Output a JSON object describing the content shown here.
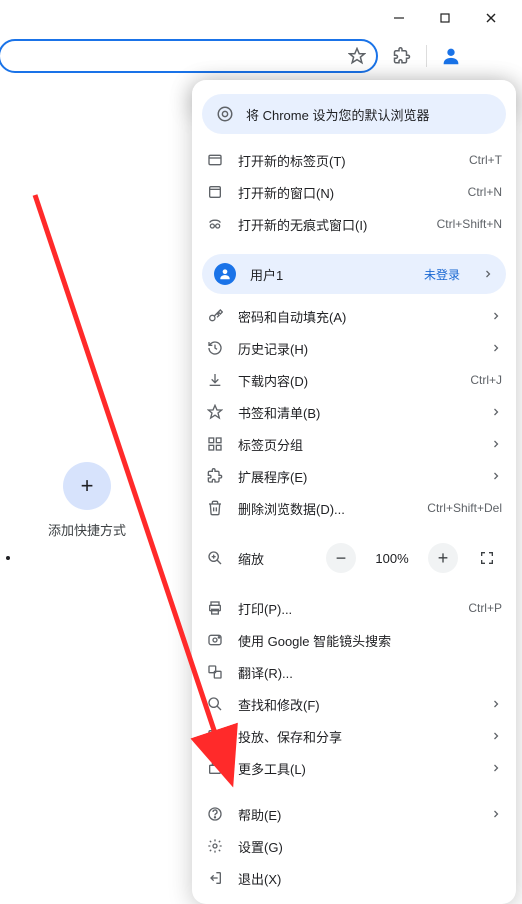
{
  "window": {},
  "toolbar": {},
  "shortcut": {
    "add_label": "添加快捷方式",
    "plus": "+"
  },
  "menu": {
    "default_browser": "将 Chrome 设为您的默认浏览器",
    "new_tab": {
      "label": "打开新的标签页(T)",
      "accel": "Ctrl+T"
    },
    "new_window": {
      "label": "打开新的窗口(N)",
      "accel": "Ctrl+N"
    },
    "incognito": {
      "label": "打开新的无痕式窗口(I)",
      "accel": "Ctrl+Shift+N"
    },
    "profile": {
      "name": "用户1",
      "status": "未登录"
    },
    "passwords": {
      "label": "密码和自动填充(A)"
    },
    "history": {
      "label": "历史记录(H)"
    },
    "downloads": {
      "label": "下载内容(D)",
      "accel": "Ctrl+J"
    },
    "bookmarks": {
      "label": "书签和清单(B)"
    },
    "tab_groups": {
      "label": "标签页分组"
    },
    "extensions": {
      "label": "扩展程序(E)"
    },
    "clear_data": {
      "label": "删除浏览数据(D)...",
      "accel": "Ctrl+Shift+Del"
    },
    "zoom": {
      "label": "缩放",
      "value": "100%"
    },
    "print": {
      "label": "打印(P)...",
      "accel": "Ctrl+P"
    },
    "lens": {
      "label": "使用 Google 智能镜头搜索"
    },
    "translate": {
      "label": "翻译(R)..."
    },
    "find": {
      "label": "查找和修改(F)"
    },
    "cast": {
      "label": "投放、保存和分享"
    },
    "more_tools": {
      "label": "更多工具(L)"
    },
    "help": {
      "label": "帮助(E)"
    },
    "settings": {
      "label": "设置(G)"
    },
    "exit": {
      "label": "退出(X)"
    }
  }
}
